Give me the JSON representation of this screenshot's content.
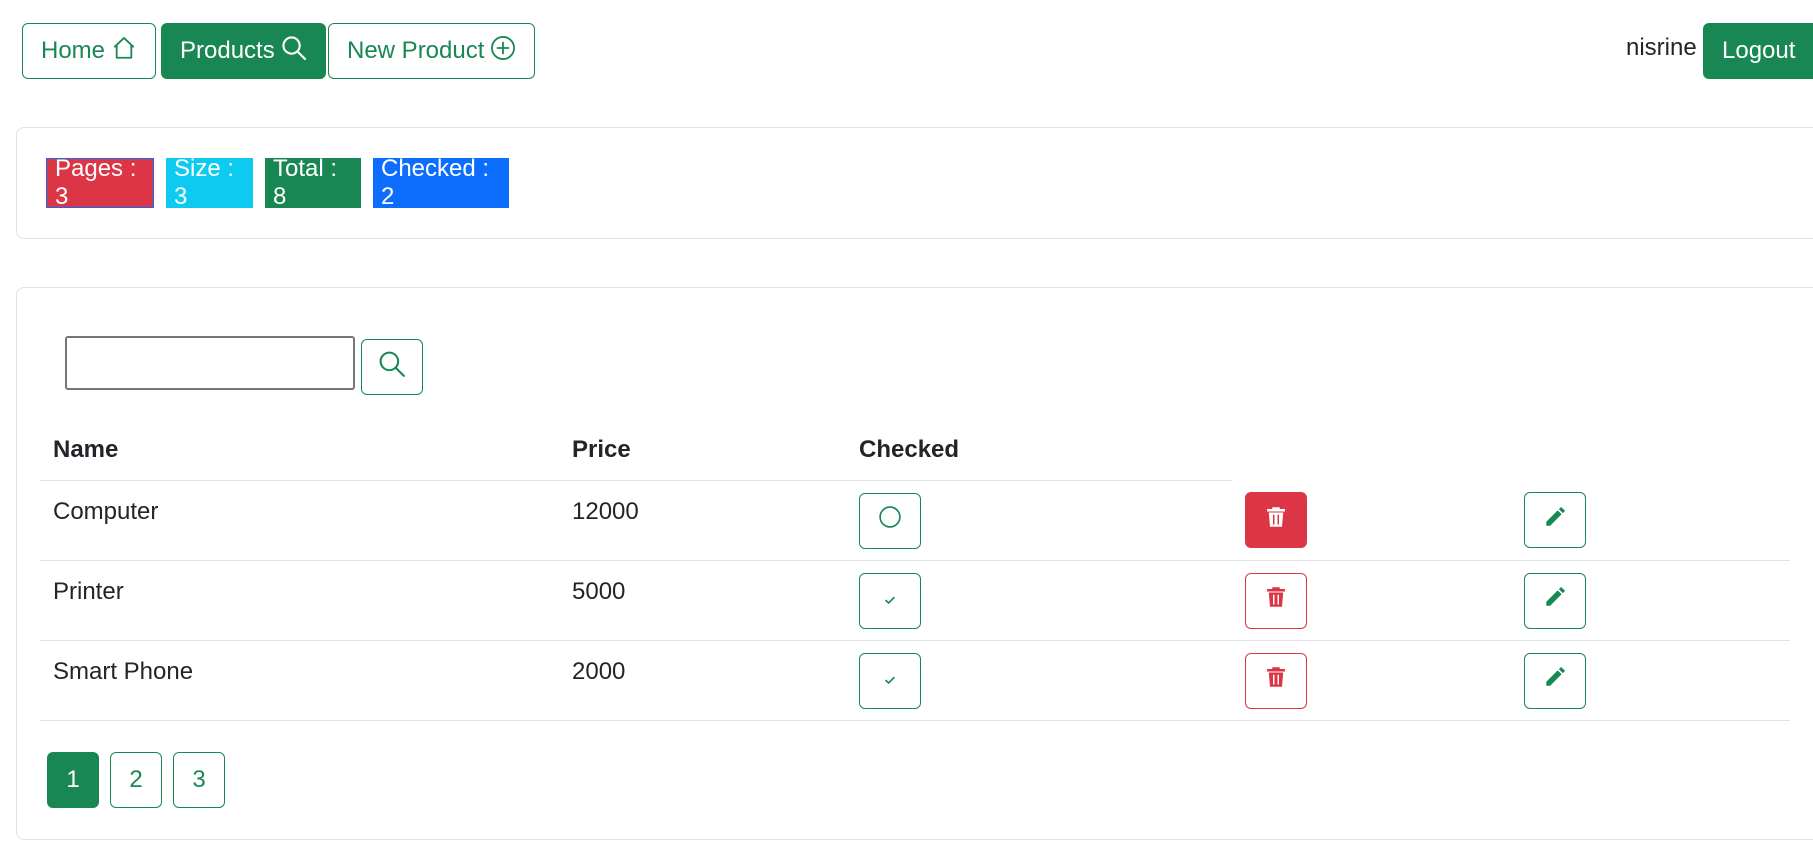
{
  "nav": {
    "home_label": "Home",
    "products_label": "Products",
    "new_product_label": "New Product",
    "username": "nisrine",
    "logout_label": "Logout"
  },
  "stats": {
    "pages": "Pages : 3",
    "size": "Size : 3",
    "total": "Total : 8",
    "checked": "Checked : 2"
  },
  "search": {
    "value": "",
    "placeholder": ""
  },
  "table": {
    "headers": [
      "Name",
      "Price",
      "Checked"
    ],
    "rows": [
      {
        "name": "Computer",
        "price": "12000",
        "checked": false
      },
      {
        "name": "Printer",
        "price": "5000",
        "checked": true
      },
      {
        "name": "Smart Phone",
        "price": "2000",
        "checked": true
      }
    ]
  },
  "pagination": {
    "pages": [
      "1",
      "2",
      "3"
    ],
    "current": "1"
  },
  "colors": {
    "success": "#198754",
    "danger": "#dc3545",
    "info": "#0dcaf0",
    "primary": "#0d6efd"
  },
  "icons": {
    "home": "house-icon",
    "products": "search-icon",
    "new_product": "plus-circle-icon",
    "unchecked": "circle-icon",
    "checked": "check-icon",
    "delete": "trash-icon",
    "edit": "pencil-icon"
  }
}
